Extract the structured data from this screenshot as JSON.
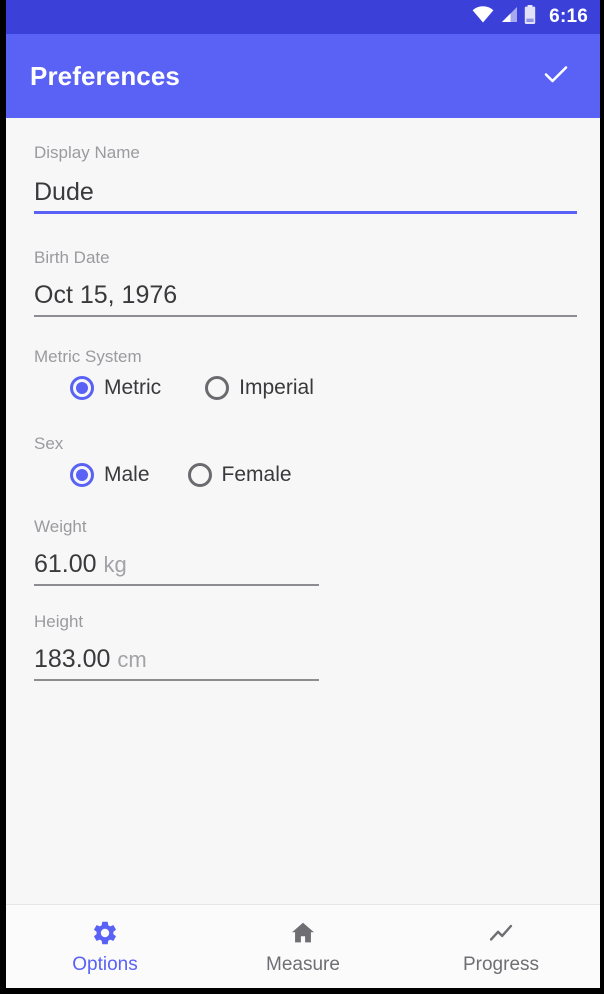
{
  "status_bar": {
    "clock": "6:16",
    "icons": [
      "wifi-icon",
      "cellular-signal-icon",
      "battery-icon"
    ],
    "background_color": "#3b41d8"
  },
  "app_bar": {
    "title": "Preferences",
    "action_icon": "check-icon",
    "background_color": "#5a62f5"
  },
  "theme": {
    "accent_color": "#5a62f5",
    "label_color": "#9b9b9f",
    "value_color": "#3a3a3c",
    "background_color": "#f7f7f8"
  },
  "form": {
    "display_name": {
      "label": "Display Name",
      "value": "Dude",
      "placeholder": "Display Name",
      "focused": true
    },
    "birth_date": {
      "label": "Birth Date",
      "value": "Oct 15, 1976",
      "placeholder": "Birth Date",
      "focused": false
    },
    "metric_system": {
      "label": "Metric System",
      "options": [
        {
          "label": "Metric",
          "selected": true
        },
        {
          "label": "Imperial",
          "selected": false
        }
      ]
    },
    "sex": {
      "label": "Sex",
      "options": [
        {
          "label": "Male",
          "selected": true
        },
        {
          "label": "Female",
          "selected": false
        }
      ]
    },
    "weight": {
      "label": "Weight",
      "value": "61.00",
      "unit": "kg",
      "placeholder": "Weight"
    },
    "height": {
      "label": "Height",
      "value": "183.00",
      "unit": "cm",
      "placeholder": "Height"
    }
  },
  "bottom_nav": {
    "items": [
      {
        "label": "Options",
        "icon": "gear-icon",
        "active": true
      },
      {
        "label": "Measure",
        "icon": "home-icon",
        "active": false
      },
      {
        "label": "Progress",
        "icon": "trending-line-icon",
        "active": false
      }
    ]
  }
}
